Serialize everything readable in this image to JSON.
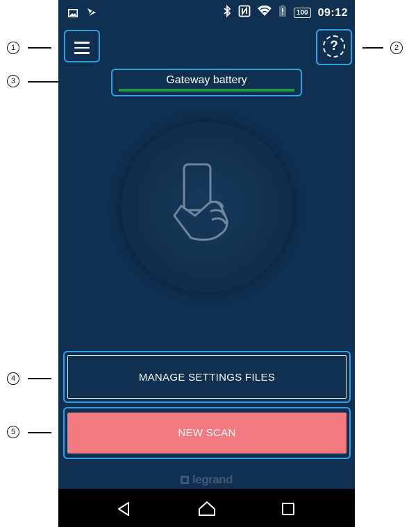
{
  "callouts": [
    {
      "number": "1"
    },
    {
      "number": "2"
    },
    {
      "number": "3"
    },
    {
      "number": "4"
    },
    {
      "number": "5"
    }
  ],
  "status_bar": {
    "left_icons": [
      "image-icon",
      "mute-icon"
    ],
    "right_icons": [
      "bluetooth-icon",
      "nfc-icon",
      "wifi-icon",
      "battery-alert-icon"
    ],
    "battery_level": "100",
    "time": "09:12"
  },
  "header": {
    "menu_icon": "hamburger-menu-icon",
    "help_icon": "help-icon",
    "help_glyph": "?"
  },
  "gateway_battery": {
    "label": "Gateway battery",
    "level_fraction": 1.0,
    "color": "#1f9a3c"
  },
  "scan_area": {
    "icon": "hand-holding-phone-icon"
  },
  "buttons": {
    "manage_settings": "MANAGE SETTINGS FILES",
    "new_scan": "NEW SCAN"
  },
  "brand": {
    "logo_text": "legrand"
  },
  "nav": {
    "back": "back-icon",
    "home": "home-icon",
    "recents": "recents-icon"
  },
  "colors": {
    "background": "#0f3050",
    "highlight": "#2aa3e6",
    "new_scan": "#f27b82"
  }
}
